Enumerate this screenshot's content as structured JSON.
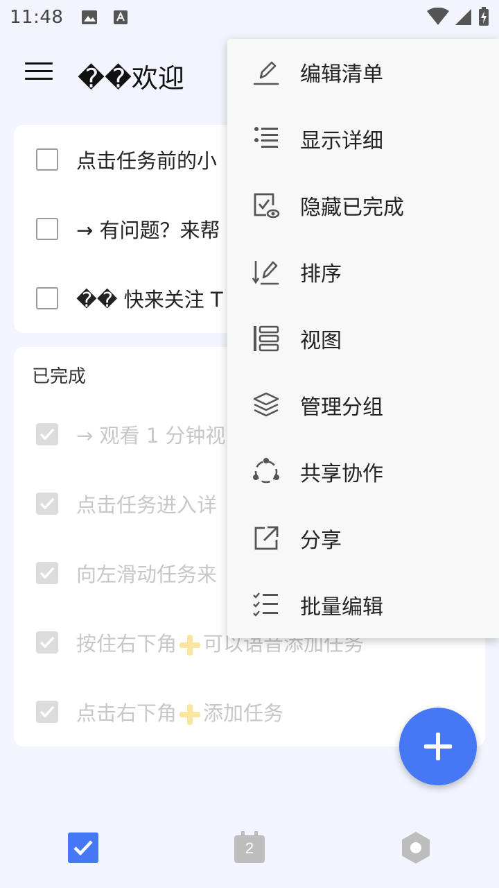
{
  "status_bar": {
    "time": "11:48"
  },
  "header": {
    "title": "��欢迎"
  },
  "todo_tasks": [
    {
      "text": "点击任务前的小"
    },
    {
      "text": "→ 有问题？来帮"
    },
    {
      "text": "�� 快来关注 T"
    }
  ],
  "completed_section": {
    "label": "已完成",
    "tasks": [
      {
        "text": "→ 观看 1 分钟视"
      },
      {
        "text": "点击任务进入详"
      },
      {
        "text": "向左滑动任务来"
      },
      {
        "text_before": "按住右下角",
        "text_after": "可以语音添加任务"
      },
      {
        "text_before": "点击右下角",
        "text_after": "添加任务"
      }
    ]
  },
  "overflow_menu": {
    "items": [
      {
        "label": "编辑清单",
        "icon": "pencil-icon"
      },
      {
        "label": "显示详细",
        "icon": "list-detail-icon"
      },
      {
        "label": "隐藏已完成",
        "icon": "hide-completed-icon"
      },
      {
        "label": "排序",
        "icon": "sort-icon"
      },
      {
        "label": "视图",
        "icon": "view-icon"
      },
      {
        "label": "管理分组",
        "icon": "layers-icon"
      },
      {
        "label": "共享协作",
        "icon": "share-collab-icon"
      },
      {
        "label": "分享",
        "icon": "share-external-icon"
      },
      {
        "label": "批量编辑",
        "icon": "batch-edit-icon"
      }
    ]
  },
  "bottom_nav": {
    "calendar_day": "2"
  },
  "colors": {
    "accent": "#4677f5",
    "background": "#f2f5fd",
    "menu_background": "#f8f8f8",
    "completed_text": "#c7c7c7"
  }
}
